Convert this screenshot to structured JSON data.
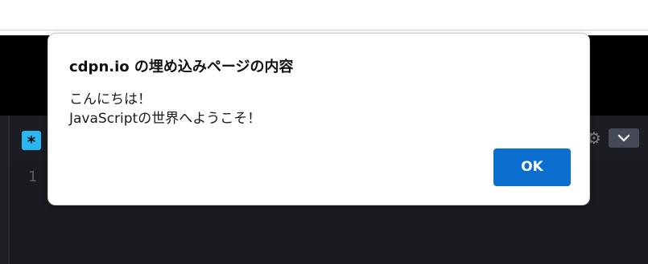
{
  "dialog": {
    "title": "cdpn.io の埋め込みページの内容",
    "message_lines": [
      "こんにちは！",
      "JavaScriptの世界へようこそ！"
    ],
    "ok_label": "OK"
  },
  "editor": {
    "badge_glyph": "*",
    "line_number": "1",
    "settings_icon": "gear-icon",
    "collapse_icon": "chevron-down-icon"
  },
  "colors": {
    "ok_button": "#0b6fd0",
    "editor_bg": "#1e1f26",
    "badge": "#2ab6f1"
  }
}
